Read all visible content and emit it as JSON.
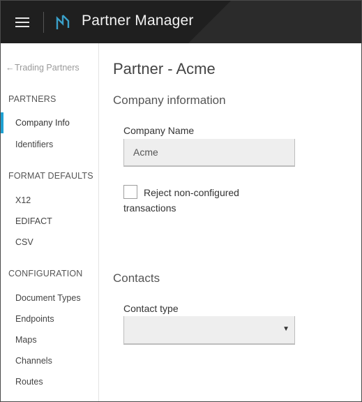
{
  "header": {
    "title": "Partner Manager",
    "menu_icon": "hamburger-menu-icon",
    "logo_icon": "partner-manager-logo-icon",
    "background_color": "#1f1f1f"
  },
  "sidebar": {
    "back_link": {
      "arrow": "←",
      "label": "Trading Partners"
    },
    "sections": [
      {
        "heading": "PARTNERS",
        "items": [
          {
            "label": "Company Info",
            "active": true
          },
          {
            "label": "Identifiers",
            "active": false
          }
        ]
      },
      {
        "heading": "FORMAT DEFAULTS",
        "items": [
          {
            "label": "X12",
            "active": false
          },
          {
            "label": "EDIFACT",
            "active": false
          },
          {
            "label": "CSV",
            "active": false
          }
        ]
      },
      {
        "heading": "CONFIGURATION",
        "items": [
          {
            "label": "Document Types",
            "active": false
          },
          {
            "label": "Endpoints",
            "active": false
          },
          {
            "label": "Maps",
            "active": false
          },
          {
            "label": "Channels",
            "active": false
          },
          {
            "label": "Routes",
            "active": false
          }
        ]
      }
    ],
    "accent_color": "#1fa1d2"
  },
  "main": {
    "page_title": "Partner - Acme",
    "company_section": {
      "title": "Company information",
      "company_name_label": "Company Name",
      "company_name_value": "Acme",
      "reject_checkbox_label": "Reject non-configured transactions",
      "reject_checked": false
    },
    "contacts_section": {
      "title": "Contacts",
      "contact_type_label": "Contact type",
      "contact_type_value": "",
      "caret": "▼"
    }
  }
}
